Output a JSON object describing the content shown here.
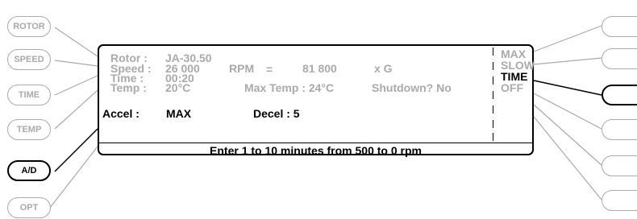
{
  "left_buttons": [
    {
      "label": "ROTOR",
      "active": false
    },
    {
      "label": "SPEED",
      "active": false
    },
    {
      "label": "TIME",
      "active": false
    },
    {
      "label": "TEMP",
      "active": false
    },
    {
      "label": "A/D",
      "active": true
    },
    {
      "label": "OPT",
      "active": false
    }
  ],
  "right_buttons_active": "TIME",
  "display": {
    "rotor_label": "Rotor :",
    "rotor_value": "JA-30.50",
    "speed_label": "Speed :",
    "speed_value": "26 000",
    "rpm_label": "RPM",
    "equals": "=",
    "g_value": "81 800",
    "g_unit": "x G",
    "time_label": "Time :",
    "time_value": "00:20",
    "temp_label": "Temp :",
    "temp_value": "20°C",
    "max_temp": "Max Temp : 24°C",
    "shutdown": "Shutdown? No",
    "accel_label": "Accel :",
    "accel_value": "MAX",
    "decel": "Decel : 5",
    "options": [
      "MAX",
      "SLOW",
      "TIME",
      "OFF"
    ],
    "footer": "Enter 1 to 10 minutes from 500 to 0 rpm"
  },
  "colors": {
    "active": "#000000",
    "inactive": "#aaaaaa"
  }
}
